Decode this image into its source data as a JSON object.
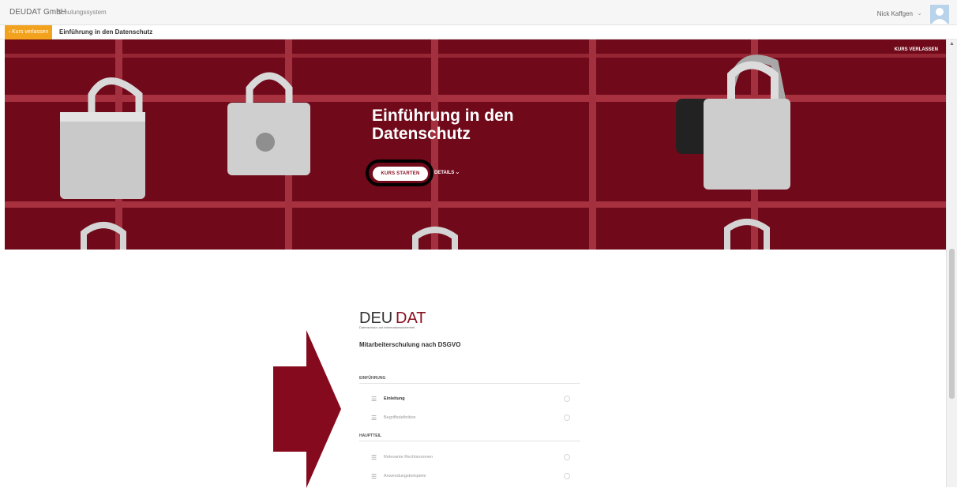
{
  "topbar": {
    "brand": "DEUDAT GmbH",
    "portal": "Schulungssystem",
    "user_name": "Nick Kaffgen",
    "user_caret": "⌄"
  },
  "coursebar": {
    "leave_label": "‹ Kurs verlassen",
    "course_title": "Einführung in den Datenschutz"
  },
  "hero": {
    "title": "Einführung in den Datenschutz",
    "start_label": "KURS STARTEN",
    "details_label": "DETAILS",
    "details_caret": "⌄",
    "leave_label": "KURS VERLASSEN"
  },
  "scrollbar": {
    "up_arrow": "▲"
  },
  "content": {
    "logo_text": "DEUDAT",
    "logo_subtitle": "Datenschutz und Informationssicherheit",
    "course_subtitle": "Mitarbeiterschulung nach DSGVO",
    "sections": [
      {
        "heading": "EINFÜHRUNG",
        "items": [
          {
            "label": "Einleitung",
            "active": true
          },
          {
            "label": "Begriffsdefinition",
            "active": false
          }
        ]
      },
      {
        "heading": "HAUPTTEIL",
        "items": [
          {
            "label": "Relevante Rechtsnormen",
            "active": false
          },
          {
            "label": "Anwendungsbeispiele",
            "active": false
          }
        ]
      }
    ]
  },
  "colors": {
    "accent_orange": "#f2a21c",
    "hero_red": "#8a1020",
    "arrow_red": "#860a1e"
  },
  "icons": [
    "user-avatar-icon",
    "chevron-left-icon",
    "chevron-down-icon",
    "lesson-lines-icon",
    "status-circle-icon",
    "arrow-right-icon"
  ]
}
